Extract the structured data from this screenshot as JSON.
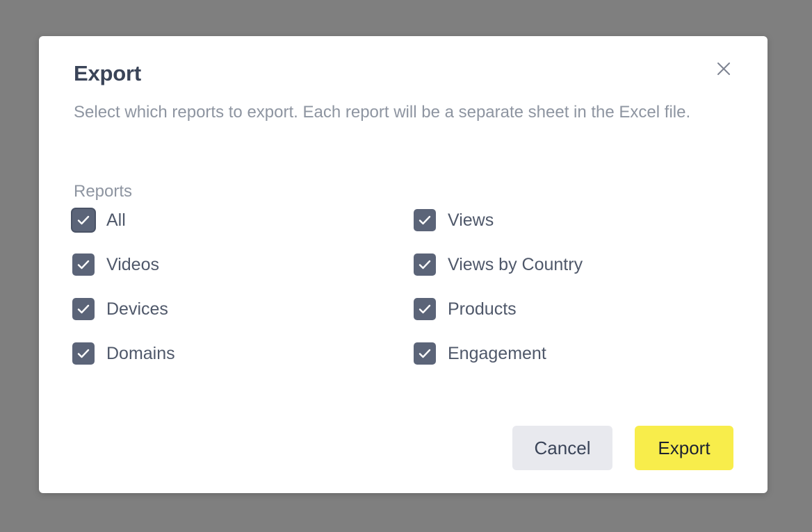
{
  "dialog": {
    "title": "Export",
    "description": "Select which reports to export. Each report will be a separate sheet in the Excel file.",
    "section_label": "Reports",
    "options": [
      {
        "label": "All",
        "checked": true
      },
      {
        "label": "Views",
        "checked": true
      },
      {
        "label": "Videos",
        "checked": true
      },
      {
        "label": "Views by Country",
        "checked": true
      },
      {
        "label": "Devices",
        "checked": true
      },
      {
        "label": "Products",
        "checked": true
      },
      {
        "label": "Domains",
        "checked": true
      },
      {
        "label": "Engagement",
        "checked": true
      }
    ],
    "cancel_label": "Cancel",
    "export_label": "Export"
  },
  "colors": {
    "backdrop": "#7f7f7f",
    "checkbox": "#5b6478",
    "export_button": "#f8ed4b",
    "cancel_button": "#e8e9ee"
  },
  "icons": {
    "close": "close-icon",
    "check": "checkmark-icon"
  }
}
